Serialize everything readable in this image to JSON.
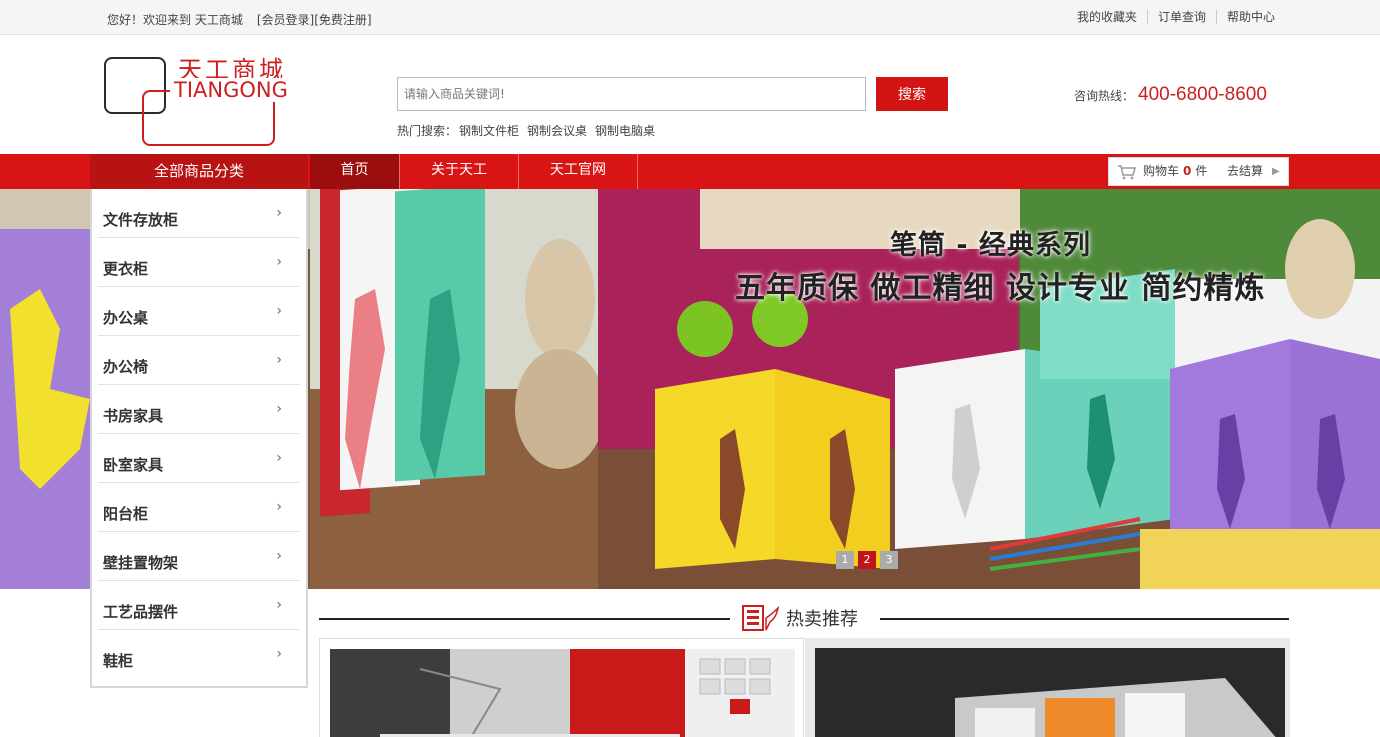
{
  "topbar": {
    "greeting": "您好！欢迎来到  天工商城",
    "login": "[会员登录]",
    "register": "[免费注册]",
    "links": [
      "我的收藏夹",
      "订单查询",
      "帮助中心"
    ]
  },
  "logo": {
    "cn": "天工商城",
    "en": "TIANGONG"
  },
  "search": {
    "placeholder": "请输入商品关键词!",
    "button": "搜索"
  },
  "hot_search": {
    "label": "热门搜索：",
    "items": [
      "钢制文件柜",
      "钢制会议桌",
      "钢制电脑桌"
    ]
  },
  "hotline": {
    "label": "咨询热线：",
    "number": "400-6800-8600"
  },
  "nav": {
    "all_categories": "全部商品分类",
    "items": [
      "首页",
      "关于天工",
      "天工官网"
    ]
  },
  "cart": {
    "label": "购物车",
    "count": "0",
    "unit": "件",
    "checkout": "去结算"
  },
  "banner": {
    "title": "笔筒 - 经典系列",
    "subtitle": "五年质保  做工精细  设计专业  简约精炼",
    "dots": [
      "1",
      "2",
      "3"
    ],
    "active_dot": 2
  },
  "categories": [
    "文件存放柜",
    "更衣柜",
    "办公桌",
    "办公椅",
    "书房家具",
    "卧室家具",
    "阳台柜",
    "壁挂置物架",
    "工艺品摆件",
    "鞋柜"
  ],
  "hot_section": {
    "title": "热卖推荐"
  },
  "colors": {
    "brand_red": "#d91414",
    "dark_red": "#b81212",
    "active_nav": "#9c0e0e"
  }
}
